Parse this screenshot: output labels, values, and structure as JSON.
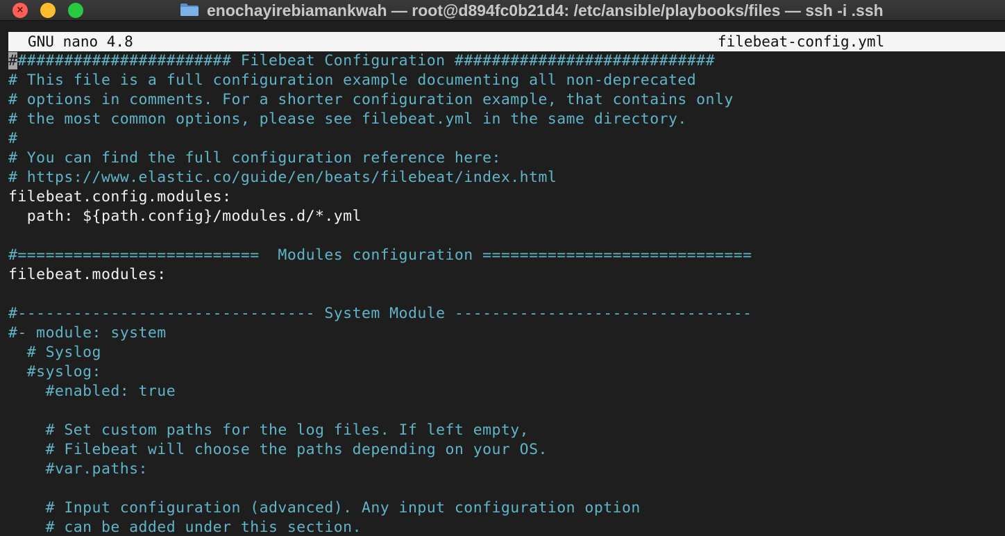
{
  "window": {
    "title": "enochayirebiamankwah — root@d894fc0b21d4: /etc/ansible/playbooks/files — ssh -i .ssh",
    "folder_icon": "folder-icon"
  },
  "nano": {
    "version": "GNU nano 4.8",
    "filename": "filebeat-config.yml"
  },
  "editor": {
    "lines": [
      {
        "text": "######################## Filebeat Configuration ############################",
        "kind": "comment"
      },
      {
        "text": "# This file is a full configuration example documenting all non-deprecated",
        "kind": "comment"
      },
      {
        "text": "# options in comments. For a shorter configuration example, that contains only",
        "kind": "comment"
      },
      {
        "text": "# the most common options, please see filebeat.yml in the same directory.",
        "kind": "comment"
      },
      {
        "text": "#",
        "kind": "comment"
      },
      {
        "text": "# You can find the full configuration reference here:",
        "kind": "comment"
      },
      {
        "text": "# https://www.elastic.co/guide/en/beats/filebeat/index.html",
        "kind": "comment"
      },
      {
        "text": "filebeat.config.modules:",
        "kind": "plain"
      },
      {
        "text": "  path: ${path.config}/modules.d/*.yml",
        "kind": "plain"
      },
      {
        "text": "",
        "kind": "plain"
      },
      {
        "text": "#==========================  Modules configuration =============================",
        "kind": "comment"
      },
      {
        "text": "filebeat.modules:",
        "kind": "plain"
      },
      {
        "text": "",
        "kind": "plain"
      },
      {
        "text": "#-------------------------------- System Module --------------------------------",
        "kind": "comment"
      },
      {
        "text": "#- module: system",
        "kind": "comment"
      },
      {
        "text": "  # Syslog",
        "kind": "comment"
      },
      {
        "text": "  #syslog:",
        "kind": "comment"
      },
      {
        "text": "    #enabled: true",
        "kind": "comment"
      },
      {
        "text": "",
        "kind": "plain"
      },
      {
        "text": "    # Set custom paths for the log files. If left empty,",
        "kind": "comment"
      },
      {
        "text": "    # Filebeat will choose the paths depending on your OS.",
        "kind": "comment"
      },
      {
        "text": "    #var.paths:",
        "kind": "comment"
      },
      {
        "text": "",
        "kind": "plain"
      },
      {
        "text": "    # Input configuration (advanced). Any input configuration option",
        "kind": "comment"
      },
      {
        "text": "    # can be added under this section.",
        "kind": "comment"
      }
    ]
  },
  "colors": {
    "comment": "#5fb5c8",
    "plain": "#f2f2f2",
    "background": "#1e1e1e",
    "header_bg": "#f5f5f5"
  }
}
